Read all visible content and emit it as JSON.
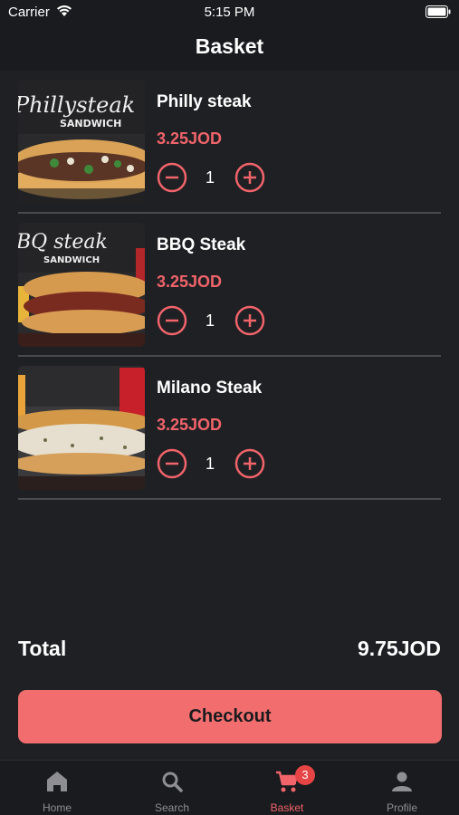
{
  "status_bar": {
    "carrier": "Carrier",
    "time": "5:15 PM"
  },
  "nav": {
    "title": "Basket"
  },
  "items": [
    {
      "name": "Philly steak",
      "price": "3.25JOD",
      "quantity": "1",
      "image_text": "Phillysteak",
      "image_subtext": "SANDWICH"
    },
    {
      "name": "BBQ Steak",
      "price": "3.25JOD",
      "quantity": "1",
      "image_text": "BQ steak",
      "image_subtext": "SANDWICH"
    },
    {
      "name": "Milano Steak",
      "price": "3.25JOD",
      "quantity": "1"
    }
  ],
  "total": {
    "label": "Total",
    "value": "9.75JOD"
  },
  "checkout": {
    "label": "Checkout"
  },
  "tabs": [
    {
      "label": "Home",
      "icon": "home-icon"
    },
    {
      "label": "Search",
      "icon": "search-icon"
    },
    {
      "label": "Basket",
      "icon": "cart-icon",
      "badge": "3",
      "active": true
    },
    {
      "label": "Profile",
      "icon": "profile-icon"
    }
  ],
  "colors": {
    "accent": "#f0646a",
    "button": "#f26e6e",
    "background": "#1f2024",
    "bar": "#1a1b1e"
  }
}
